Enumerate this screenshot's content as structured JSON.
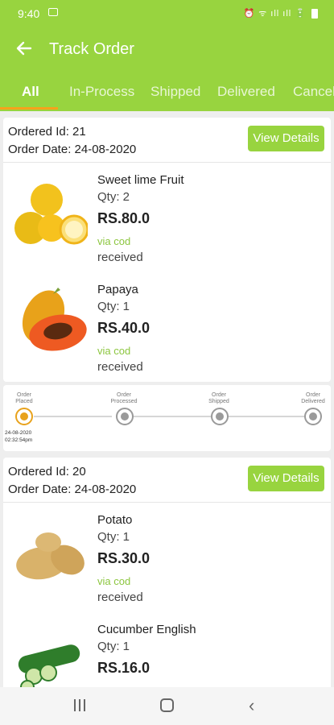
{
  "status_bar": {
    "time": "9:40",
    "right_icons": "⏰ ᯤ ıll ıll 🔋"
  },
  "header": {
    "title": "Track Order",
    "back_icon": "arrow-left-icon"
  },
  "tabs": [
    {
      "label": "All",
      "active": true
    },
    {
      "label": "In-Process",
      "active": false
    },
    {
      "label": "Shipped",
      "active": false
    },
    {
      "label": "Delivered",
      "active": false
    },
    {
      "label": "Cancel",
      "active": false
    }
  ],
  "orders": [
    {
      "id_label": "Ordered Id:  21",
      "date_label": "Order Date:  24-08-2020",
      "button": "View Details",
      "items": [
        {
          "name": "Sweet lime Fruit",
          "qty": "Qty: 2",
          "price": "RS.80.0",
          "via": "via cod",
          "status": "received"
        },
        {
          "name": "Papaya",
          "qty": "Qty: 1",
          "price": "RS.40.0",
          "via": "via cod",
          "status": "received"
        }
      ]
    },
    {
      "id_label": "Ordered Id:  20",
      "date_label": "Order Date:  24-08-2020",
      "button": "View Details",
      "items": [
        {
          "name": "Potato",
          "qty": "Qty: 1",
          "price": "RS.30.0",
          "via": "via cod",
          "status": "received"
        },
        {
          "name": "Cucumber English",
          "qty": "Qty: 1",
          "price": "RS.16.0"
        }
      ]
    }
  ],
  "tracker": {
    "steps": [
      {
        "label": "Order Placed",
        "done": true
      },
      {
        "label": "Order Processed",
        "done": false
      },
      {
        "label": "Order Shipped",
        "done": false
      },
      {
        "label": "Order Delivered",
        "done": false
      }
    ],
    "placed_date": "24-08-2020",
    "placed_time": "02:32:54pm"
  },
  "colors": {
    "primary": "#98d43f",
    "accent": "#f7a21b",
    "via_text": "#8cc63f"
  }
}
